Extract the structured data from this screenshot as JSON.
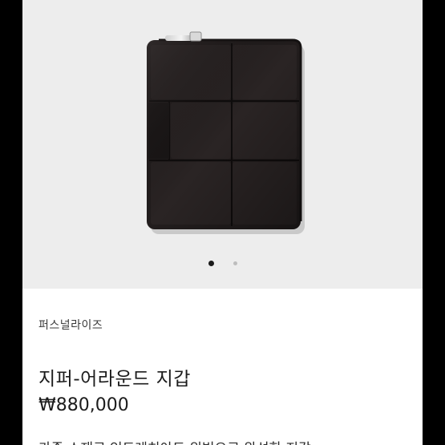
{
  "product": {
    "brand": "퍼스널라이즈",
    "name": "지퍼-어라운드 지갑",
    "price": "₩880,000",
    "description_partial": "가죽 소재로 인트레치아토 위빙으로 완성한 지갑"
  },
  "gallery": {
    "image": "wallet-photo",
    "dots": [
      {
        "active": true
      },
      {
        "active": false
      }
    ]
  },
  "colors": {
    "background": "#000000",
    "gallery_bg": "#ededed",
    "wallet": "#201c1c",
    "dot_active": "#1a1a1a",
    "dot_inactive": "#bdbdbd"
  }
}
